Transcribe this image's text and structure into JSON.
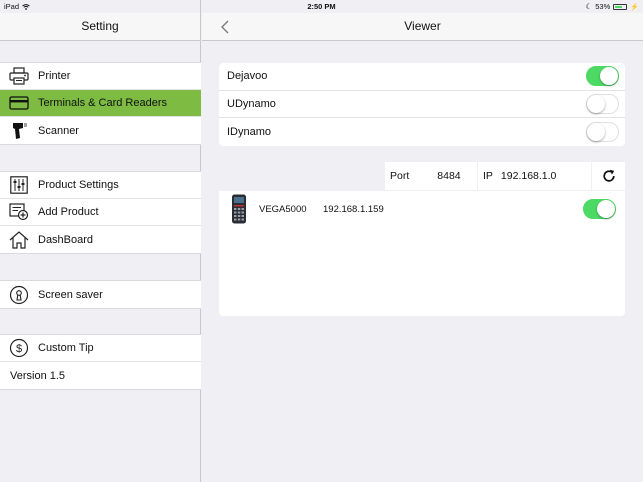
{
  "status_bar": {
    "device": "iPad",
    "time": "2:50 PM",
    "battery": "53%",
    "battery_level": 0.53
  },
  "sidebar": {
    "title": "Setting",
    "group1": [
      {
        "label": "Printer",
        "icon": "printer-icon",
        "selected": false
      },
      {
        "label": "Terminals & Card Readers",
        "icon": "card-icon",
        "selected": true
      },
      {
        "label": "Scanner",
        "icon": "scanner-icon",
        "selected": false
      }
    ],
    "group2": [
      {
        "label": "Product Settings",
        "icon": "sliders-icon"
      },
      {
        "label": "Add Product",
        "icon": "add-product-icon"
      },
      {
        "label": "DashBoard",
        "icon": "home-icon"
      }
    ],
    "group3": [
      {
        "label": "Screen saver",
        "icon": "keyhole-icon"
      }
    ],
    "group4": [
      {
        "label": "Custom Tip",
        "icon": "dollar-icon"
      },
      {
        "label": "Version 1.5"
      }
    ]
  },
  "main": {
    "title": "Viewer",
    "readers": [
      {
        "label": "Dejavoo",
        "on": true
      },
      {
        "label": "UDynamo",
        "on": false
      },
      {
        "label": "IDynamo",
        "on": false
      }
    ],
    "port": {
      "label": "Port",
      "value": "8484"
    },
    "ip": {
      "label": "IP",
      "value": "192.168.1.0"
    },
    "device": {
      "name": "VEGA5000",
      "address": "192.168.1.159",
      "on": true
    }
  },
  "colors": {
    "selected_row": "#7dbb42",
    "toggle_on": "#4cd964",
    "background": "#efeff4"
  }
}
